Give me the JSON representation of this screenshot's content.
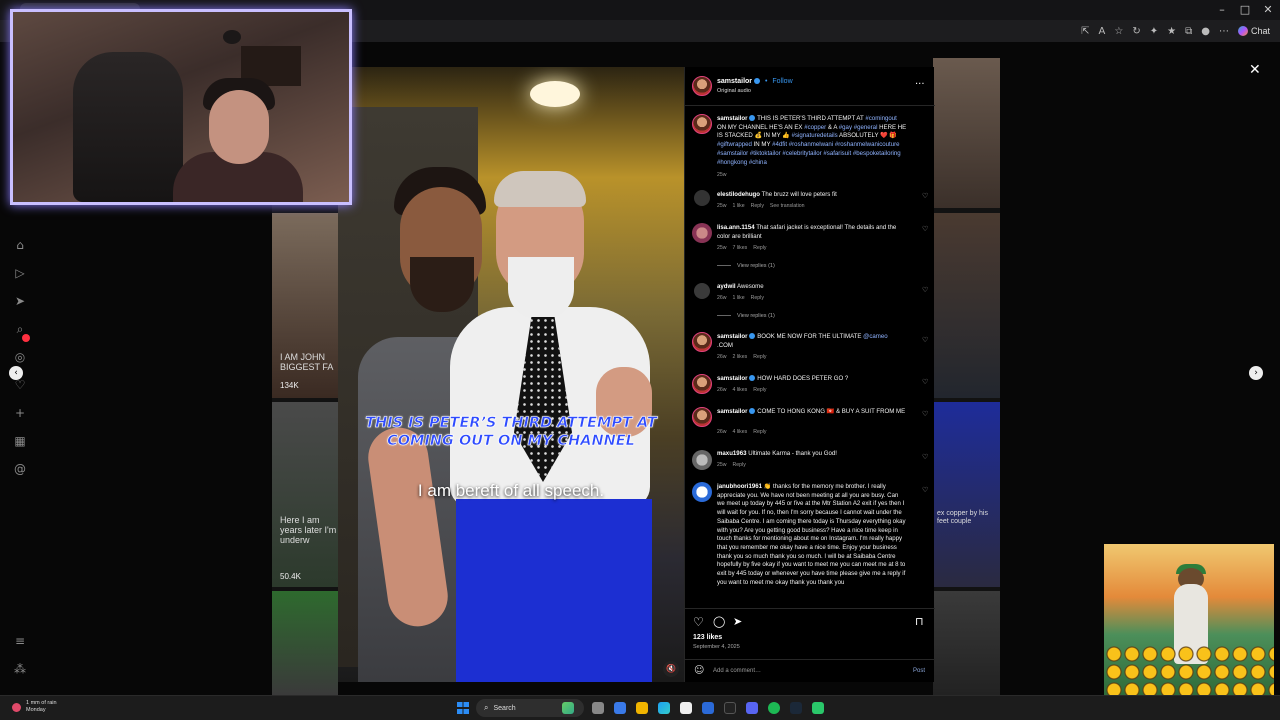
{
  "browser": {
    "chat_label": "Chat",
    "window_controls": [
      "–",
      "□",
      "✕"
    ]
  },
  "post": {
    "username": "samstailor",
    "follow_label": "Follow",
    "separator": "•",
    "audio": "Original audio",
    "overlay_title": "THIS IS PETER’S THIRD ATTEMPT AT COMING OUT ON MY CHANNEL",
    "overlay_subtitle": "I am bereft of all speech.",
    "caption": {
      "user": "samstailor",
      "text_1": "THIS IS PETER'S THIRD ATTEMPT AT",
      "tag_1": "#comingout",
      "text_2": "ON MY CHANNEL HE'S AN EX",
      "tag_2": "#copper",
      "text_3": "& A",
      "tag_3": "#gay",
      "tag_4": "#general",
      "text_4": "HERE HE IS STACKED 💰 IN MY 👍",
      "tag_5": "#signaturedetails",
      "text_5": "ABSOLUTELY ❤️ 🎁",
      "tag_6": "#giftwrapped",
      "text_6": "IN MY",
      "tag_7": "#4dfit",
      "tag_8": "#roshanmelwani",
      "tag_9": "#roshanmelwanicouture",
      "tag_10": "#samstailor",
      "tag_11": "#tiktoktailor",
      "tag_12": "#celebritytailor",
      "tag_13": "#safarisuit",
      "tag_14": "#bespoketailoring",
      "tag_15": "#hongkong",
      "tag_16": "#china",
      "time": "25w"
    },
    "comments": [
      {
        "user": "elestilodehugo",
        "text": "The bruzz will love peters fit",
        "time": "25w",
        "likes": "1 like",
        "reply": "Reply",
        "extra": "See translation"
      },
      {
        "user": "lisa.ann.1154",
        "text": "That safari jacket is exceptional! The details and the color are brilliant",
        "time": "25w",
        "likes": "7 likes",
        "reply": "Reply",
        "view_replies": "View replies (1)"
      },
      {
        "user": "aydwil",
        "text": "Awesome",
        "time": "26w",
        "likes": "1 like",
        "reply": "Reply",
        "view_replies": "View replies (1)"
      },
      {
        "user": "samstailor",
        "text": "BOOK ME NOW FOR THE ULTIMATE",
        "tag": "@cameo",
        "text_after": ".COM",
        "time": "26w",
        "likes": "2 likes",
        "reply": "Reply"
      },
      {
        "user": "samstailor",
        "text": "HOW HARD DOES PETER GO ?",
        "time": "26w",
        "likes": "4 likes",
        "reply": "Reply"
      },
      {
        "user": "samstailor",
        "text": "COME TO HONG KONG 🇭🇰 & BUY A SUIT FROM ME",
        "time": "26w",
        "likes": "4 likes",
        "reply": "Reply"
      },
      {
        "user": "maxu1963",
        "text": "Ultimate Karma - thank you God!",
        "time": "25w",
        "reply": "Reply"
      },
      {
        "user": "janubhoori1961",
        "text": "👏 thanks for the memory me brother. I really appreciate you. We have not been meeting at all you are busy. Can we meet up today by 445 or five at the Mtr Station A2 exit if yes then I will wait for you. If no, then I'm sorry because I cannot wait under the Saibaba Centre. I am coming there today is Thursday everything okay with you? Are you getting good business? Have a nice time keep in touch thanks for mentioning about me on Instagram. I'm really happy that you remember me okay have a nice time. Enjoy your business thank you so much thank you so much. I will be at Saibaba Centre hopefully by five okay if you want to meet me you can meet me at 8 to exit by 445 today or whenever you have time please give me a reply if you want to meet me okay thank you thank you"
      }
    ],
    "likes_count": "123 likes",
    "date": "September 4, 2025",
    "add_comment_placeholder": "Add a comment…",
    "post_button": "Post"
  },
  "grid_left": [
    {
      "caption": "I AM JOHN BIGGEST FA",
      "views": "134K"
    },
    {
      "caption": "Here I am years later I'm underw",
      "views": "50.4K"
    }
  ],
  "grid_right": [
    {
      "caption": "ex copper by his feet couple"
    }
  ],
  "taskbar": {
    "weather_line1": "1 mm of rain",
    "weather_line2": "Monday",
    "search_label": "Search"
  },
  "icons": {
    "close": "✕",
    "prev": "‹",
    "next": "›",
    "more": "···",
    "heart": "♡",
    "comment": "◯",
    "share": "➤",
    "bookmark": "⊓",
    "emoji": "☺",
    "mute": "🔇",
    "search": "⌕"
  }
}
